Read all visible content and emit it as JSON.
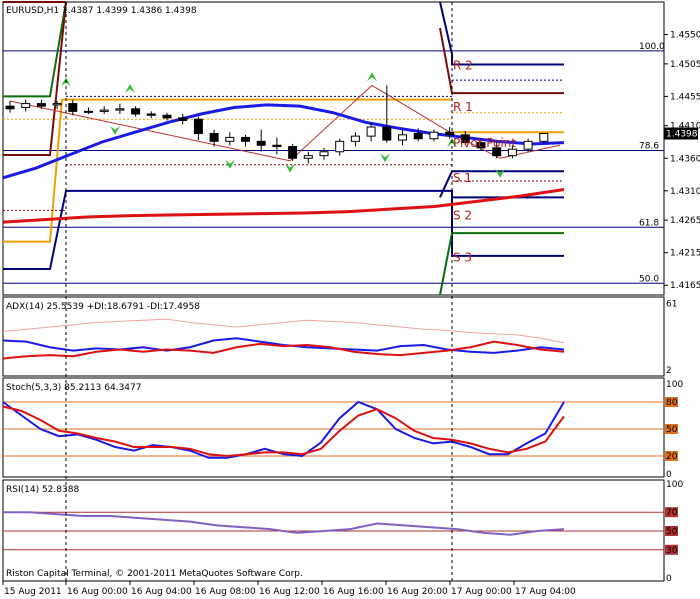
{
  "colors": {
    "bull_candle": "#ffffff",
    "bear_candle": "#000000",
    "ma_blue": "#1a1ae6",
    "ma_red": "#dd1111",
    "channel_blue": "#00007a",
    "channel_maroon": "#7a0a0a",
    "channel_green": "#0a6e0a",
    "channel_orange": "#f0a000",
    "fractal_green": "#33bb33",
    "pivot_text": "#b02020",
    "fib_line": "#000080",
    "stoch_level": "#e07020",
    "rsi_level": "#b03030",
    "adx_di_plus": "#1a1ae6",
    "adx_di_minus": "#dd1111",
    "rsi_line": "#8060c0",
    "sep_line": "#000000"
  },
  "chart_data": [
    {
      "type": "candlestick",
      "title": "EURUSD,H1",
      "ohlc_readout": "1.4387 1.4399 1.4386 1.4398",
      "current_price": "1.4398",
      "ylim": [
        1.415,
        1.46
      ],
      "y_ticks": [
        "1.4550",
        "1.4505",
        "1.4455",
        "1.4410",
        "1.4360",
        "1.4310",
        "1.4265",
        "1.4215",
        "1.4165"
      ],
      "fib_levels": [
        {
          "label": "100.0",
          "value": 1.4525
        },
        {
          "label": "78.6",
          "value": 1.4372
        },
        {
          "label": "61.8",
          "value": 1.4254
        },
        {
          "label": "50.0",
          "value": 1.4168
        }
      ],
      "pivot_labels": [
        {
          "text": "R 2",
          "value": 1.4504
        },
        {
          "text": "R 1",
          "value": 1.444
        },
        {
          "text": "Pivot Point",
          "value": 1.4385
        },
        {
          "text": "S 1",
          "value": 1.4331
        },
        {
          "text": "S 2",
          "value": 1.4274
        },
        {
          "text": "S 3",
          "value": 1.4209
        }
      ],
      "candles": [
        {
          "o": 1.444,
          "h": 1.4448,
          "l": 1.443,
          "c": 1.4436
        },
        {
          "o": 1.4438,
          "h": 1.445,
          "l": 1.4432,
          "c": 1.4444
        },
        {
          "o": 1.4444,
          "h": 1.445,
          "l": 1.4436,
          "c": 1.444
        },
        {
          "o": 1.4442,
          "h": 1.4448,
          "l": 1.4436,
          "c": 1.4444
        },
        {
          "o": 1.4444,
          "h": 1.445,
          "l": 1.4426,
          "c": 1.4432
        },
        {
          "o": 1.4432,
          "h": 1.4438,
          "l": 1.4428,
          "c": 1.4432
        },
        {
          "o": 1.4432,
          "h": 1.444,
          "l": 1.4428,
          "c": 1.4434
        },
        {
          "o": 1.4434,
          "h": 1.4444,
          "l": 1.4428,
          "c": 1.4436
        },
        {
          "o": 1.4436,
          "h": 1.444,
          "l": 1.4424,
          "c": 1.4428
        },
        {
          "o": 1.4428,
          "h": 1.4432,
          "l": 1.4422,
          "c": 1.4426
        },
        {
          "o": 1.4426,
          "h": 1.443,
          "l": 1.4418,
          "c": 1.4422
        },
        {
          "o": 1.4422,
          "h": 1.4428,
          "l": 1.4412,
          "c": 1.4418
        },
        {
          "o": 1.442,
          "h": 1.4424,
          "l": 1.4388,
          "c": 1.4398
        },
        {
          "o": 1.4398,
          "h": 1.4404,
          "l": 1.4378,
          "c": 1.4386
        },
        {
          "o": 1.4386,
          "h": 1.44,
          "l": 1.438,
          "c": 1.4392
        },
        {
          "o": 1.4392,
          "h": 1.4396,
          "l": 1.4378,
          "c": 1.4386
        },
        {
          "o": 1.4386,
          "h": 1.4404,
          "l": 1.437,
          "c": 1.438
        },
        {
          "o": 1.438,
          "h": 1.4392,
          "l": 1.4366,
          "c": 1.4378
        },
        {
          "o": 1.4378,
          "h": 1.4382,
          "l": 1.4356,
          "c": 1.436
        },
        {
          "o": 1.436,
          "h": 1.437,
          "l": 1.4352,
          "c": 1.4364
        },
        {
          "o": 1.4364,
          "h": 1.4376,
          "l": 1.4358,
          "c": 1.437
        },
        {
          "o": 1.437,
          "h": 1.439,
          "l": 1.4364,
          "c": 1.4386
        },
        {
          "o": 1.4386,
          "h": 1.44,
          "l": 1.4378,
          "c": 1.4394
        },
        {
          "o": 1.4394,
          "h": 1.4414,
          "l": 1.4386,
          "c": 1.4408
        },
        {
          "o": 1.4408,
          "h": 1.4472,
          "l": 1.4384,
          "c": 1.4388
        },
        {
          "o": 1.4388,
          "h": 1.4404,
          "l": 1.438,
          "c": 1.4396
        },
        {
          "o": 1.4398,
          "h": 1.4406,
          "l": 1.4386,
          "c": 1.439
        },
        {
          "o": 1.439,
          "h": 1.4404,
          "l": 1.4386,
          "c": 1.44
        },
        {
          "o": 1.44,
          "h": 1.4408,
          "l": 1.439,
          "c": 1.4396
        },
        {
          "o": 1.4396,
          "h": 1.4402,
          "l": 1.438,
          "c": 1.4384
        },
        {
          "o": 1.4384,
          "h": 1.439,
          "l": 1.4372,
          "c": 1.4376
        },
        {
          "o": 1.4376,
          "h": 1.4384,
          "l": 1.436,
          "c": 1.4364
        },
        {
          "o": 1.4364,
          "h": 1.438,
          "l": 1.436,
          "c": 1.4374
        },
        {
          "o": 1.4374,
          "h": 1.439,
          "l": 1.437,
          "c": 1.4386
        },
        {
          "o": 1.4386,
          "h": 1.4399,
          "l": 1.4384,
          "c": 1.4398
        }
      ],
      "ma_blue": [
        1.433,
        1.4345,
        1.4365,
        1.4385,
        1.44,
        1.4415,
        1.4428,
        1.4438,
        1.4442,
        1.444,
        1.443,
        1.4415,
        1.4406,
        1.4398,
        1.4392,
        1.4386,
        1.4382,
        1.4384
      ],
      "ma_red": [
        1.4262,
        1.4266,
        1.427,
        1.4272,
        1.4273,
        1.4274,
        1.4275,
        1.4276,
        1.4278,
        1.4282,
        1.4286,
        1.4294,
        1.4302,
        1.4312
      ],
      "fractals_up": [
        1.4478,
        1.4468,
        1.4486,
        1.4385
      ],
      "fractals_down": [
        1.4402,
        1.435,
        1.4344,
        1.436,
        1.4336
      ]
    },
    {
      "type": "line",
      "title": "ADX(14) 25.5539 +DI:18.6791 -DI:17.4958",
      "y_ticks": [
        "61",
        "2"
      ],
      "series": [
        {
          "name": "ADX",
          "values": [
            36,
            38,
            40,
            42,
            44,
            45,
            46,
            47,
            44,
            42,
            40,
            42,
            44,
            46,
            45,
            44,
            42,
            40,
            38,
            37,
            35,
            34,
            33,
            30,
            26
          ]
        },
        {
          "name": "+DI",
          "values": [
            28,
            27,
            22,
            19,
            21,
            20,
            22,
            19,
            22,
            28,
            30,
            27,
            24,
            22,
            21,
            20,
            19,
            23,
            24,
            20,
            18,
            17,
            19,
            22,
            20
          ]
        },
        {
          "name": "-DI",
          "values": [
            12,
            14,
            15,
            14,
            18,
            20,
            18,
            20,
            19,
            17,
            22,
            25,
            23,
            24,
            22,
            18,
            16,
            15,
            17,
            19,
            22,
            27,
            24,
            20,
            18
          ]
        }
      ]
    },
    {
      "type": "line",
      "title": "Stoch(5,3,3) 85.2113 64.3477",
      "y_ticks": [
        "100",
        "80",
        "50",
        "20",
        "0"
      ],
      "series": [
        {
          "name": "main",
          "values": [
            80,
            65,
            50,
            42,
            44,
            38,
            30,
            26,
            32,
            30,
            26,
            18,
            18,
            22,
            28,
            22,
            20,
            35,
            62,
            80,
            72,
            50,
            40,
            34,
            36,
            30,
            22,
            22,
            34,
            45,
            80
          ]
        },
        {
          "name": "signal",
          "values": [
            75,
            70,
            60,
            48,
            45,
            40,
            36,
            30,
            30,
            30,
            28,
            22,
            20,
            22,
            24,
            24,
            22,
            28,
            48,
            65,
            72,
            62,
            48,
            40,
            38,
            34,
            28,
            24,
            28,
            36,
            64
          ]
        }
      ]
    },
    {
      "type": "line",
      "title": "RSI(14) 52.8388",
      "y_ticks": [
        "100",
        "70",
        "50",
        "30",
        "0"
      ],
      "copyright": "Riston Capital Terminal, © 2001-2011 MetaQuotes Software Corp.",
      "series": [
        {
          "name": "RSI",
          "values": [
            70,
            70,
            68,
            66,
            66,
            64,
            62,
            60,
            56,
            54,
            52,
            48,
            50,
            52,
            58,
            56,
            54,
            52,
            48,
            46,
            50,
            52
          ]
        }
      ]
    }
  ],
  "x_axis_labels": [
    "15 Aug 2011",
    "16 Aug 00:00",
    "16 Aug 04:00",
    "16 Aug 08:00",
    "16 Aug 12:00",
    "16 Aug 16:00",
    "16 Aug 20:00",
    "17 Aug 00:00",
    "17 Aug 04:00"
  ]
}
